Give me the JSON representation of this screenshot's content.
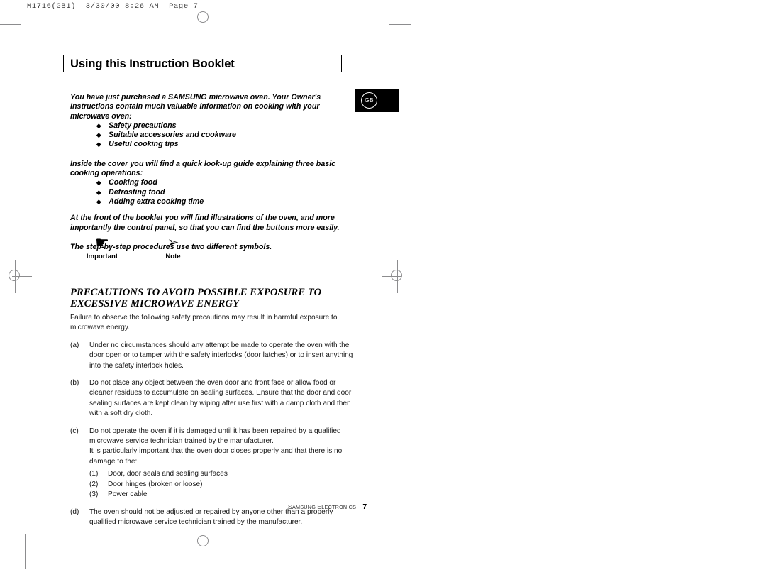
{
  "page": {
    "slug": "M1716(GB1)  3/30/00 8:26 AM  Page 7",
    "title": "Using this Instruction Booklet",
    "region_badge": "GB"
  },
  "intro": {
    "lines": [
      "You have just purchased a SAMSUNG microwave oven. Your Owner's",
      "Instructions contain much valuable information on cooking with your",
      "microwave oven:"
    ],
    "bullet_glyph": "◆",
    "bullets": [
      "Safety precautions",
      "Suitable accessories and cookware",
      "Useful cooking tips"
    ]
  },
  "guide": {
    "lines": [
      "Inside the cover you will find a quick look-up guide explaining three basic",
      "cooking operations:"
    ],
    "bullets": [
      "Cooking food",
      "Defrosting food",
      "Adding extra cooking time"
    ]
  },
  "front_note": {
    "lines": [
      "At the front of the booklet you will find illustrations of the oven, and more",
      "importantly the control panel,  so that you can find the buttons more easily."
    ]
  },
  "symbols_intro": "The step-by-step procedures use two different symbols.",
  "symbols": [
    {
      "glyph": "☛",
      "icon": "pointing-hand-icon",
      "caption": "Important"
    },
    {
      "glyph": "➢",
      "icon": "arrow-dart-icon",
      "caption": "Note"
    }
  ],
  "precautions": {
    "heading_lines": [
      "PRECAUTIONS TO AVOID POSSIBLE EXPOSURE TO",
      "EXCESSIVE MICROWAVE ENERGY"
    ],
    "lead": "Failure to observe the following safety precautions may result in harmful exposure to microwave energy.",
    "items": [
      {
        "marker": "(a)",
        "text": "Under no circumstances should any attempt be made to operate the oven with the door open or to tamper with the safety interlocks (door latches) or to insert anything into the safety interlock holes."
      },
      {
        "marker": "(b)",
        "text": "Do not place any object between the oven door and front face or allow food or cleaner residues to accumulate on sealing surfaces. Ensure that the door and door sealing surfaces are kept clean by wiping after use first with a damp cloth and then with a soft dry cloth."
      },
      {
        "marker": "(c)",
        "text": "Do not operate the oven if it is damaged until it has been repaired by a qualified microwave service technician trained by the manufacturer.",
        "extra": "It is particularly important that the oven door closes properly and that there is no damage to the:",
        "sub_items": [
          {
            "marker": "(1)",
            "text": "Door, door seals and sealing surfaces"
          },
          {
            "marker": "(2)",
            "text": "Door hinges (broken or loose)"
          },
          {
            "marker": "(3)",
            "text": "Power cable"
          }
        ]
      },
      {
        "marker": "(d)",
        "text": "The oven should not be adjusted or repaired by anyone other than a properly qualified microwave service technician trained by the manufacturer."
      }
    ]
  },
  "footer": {
    "brand_first": "S",
    "brand_rest": "AMSUNG",
    "division_first": "E",
    "division_rest": "LECTRONICS",
    "page_number": "7"
  }
}
